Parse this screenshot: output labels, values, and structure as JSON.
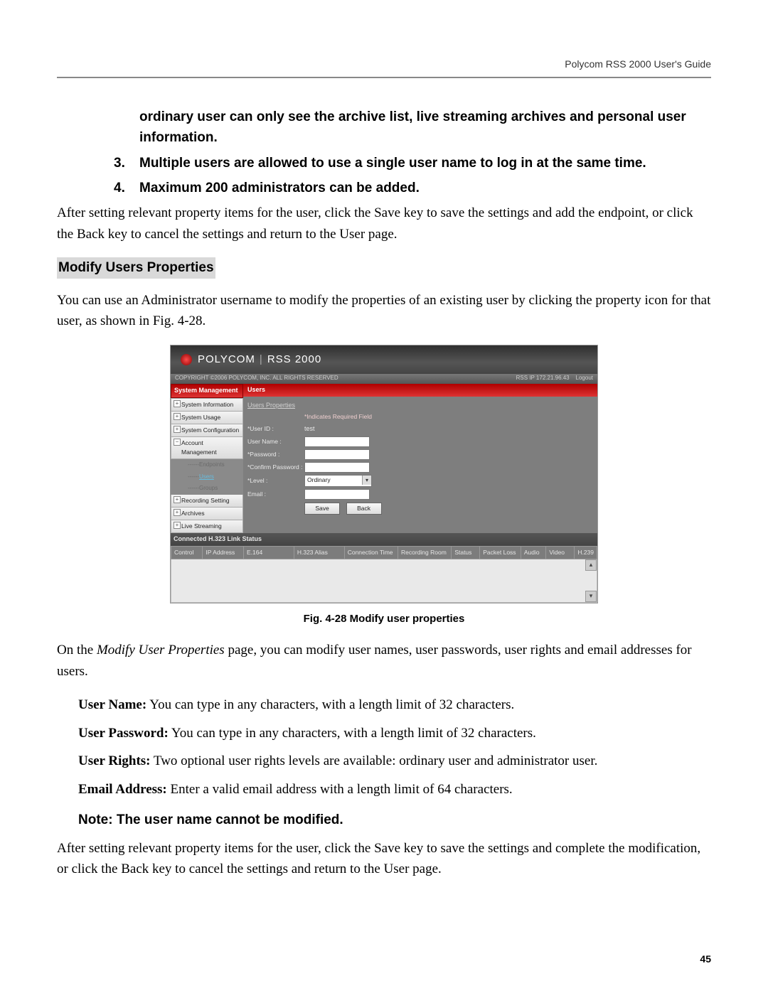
{
  "header": {
    "title": "Polycom RSS 2000 User's Guide"
  },
  "ol": {
    "i2": {
      "text": "ordinary user can only see the archive list, live streaming archives and personal user information."
    },
    "i3": {
      "num": "3.",
      "text": "Multiple users are allowed to use a single user name to log in at the same time."
    },
    "i4": {
      "num": "4.",
      "text": "Maximum 200 administrators can be added."
    }
  },
  "para1": "After setting relevant property items for the user, click the Save key to save the settings and add the endpoint, or click the Back key to cancel the settings and return to the User page.",
  "section_heading": "Modify Users Properties",
  "para2": "You can use an Administrator username to modify the properties of an existing user by clicking the property icon for that user, as shown in Fig. 4-28.",
  "caption": "Fig. 4-28 Modify user properties",
  "intro3a": "  On the ",
  "intro3_em": "Modify User Properties",
  "intro3b": " page, you can modify user names, user passwords, user rights and email addresses for users.",
  "fields": {
    "uname": {
      "label": "User Name:",
      "text": " You can type in any characters, with a length limit of 32 characters."
    },
    "upass": {
      "label": "User Password:",
      "text": " You can type in any characters, with a length limit of 32 characters."
    },
    "uright": {
      "label": "User Rights:",
      "text": " Two optional user rights levels are available: ordinary user and administrator user."
    },
    "uemail": {
      "label": "Email Address:",
      "text": " Enter a valid email address with a length limit of 64 characters."
    }
  },
  "note": {
    "prefix": "Note:",
    "text": "   The user name cannot be modified."
  },
  "para4": "After setting relevant property items for the user, click the Save key to save the settings and complete the modification, or click the Back key to cancel the settings and return to the User page.",
  "pagenum": "45",
  "shot": {
    "brand1": "POLYCOM",
    "brand_sep": "|",
    "brand2": "RSS 2000",
    "subleft": "COPYRIGHT ©2006 POLYCOM, INC. ALL RIGHTS RESERVED",
    "subright_ip_label": "RSS IP",
    "subright_ip": "172.21.96.43",
    "subright_logout": "Logout",
    "side_hdr": "System Management",
    "side": {
      "sysinfo": "System Information",
      "sysusage": "System Usage",
      "sysconfig": "System Configuration",
      "acctmgmt": "Account Management",
      "endpoints": "------Endpoints",
      "users": "Users",
      "groups": "------Groups",
      "recset": "Recording Setting",
      "archives": "Archives",
      "live": "Live Streaming"
    },
    "main_hdr": "Users",
    "crumb": "Users Properties",
    "req": "*Indicates Required Field",
    "form": {
      "userid_label": "*User ID :",
      "userid_value": "test",
      "uname_label": "User Name :",
      "pwd_label": "*Password :",
      "cpwd_label": "*Confirm Password :",
      "level_label": "*Level :",
      "level_value": "Ordinary",
      "email_label": "Email :",
      "save": "Save",
      "back": "Back"
    },
    "status_hdr": "Connected H.323 Link Status",
    "cols": {
      "ctrl": "Control",
      "ip": "IP Address",
      "e164": "E.164",
      "alias": "H.323 Alias",
      "ctime": "Connection Time",
      "room": "Recording Room",
      "status": "Status",
      "ploss": "Packet Loss",
      "audio": "Audio",
      "video": "Video",
      "h239": "H.239"
    }
  }
}
